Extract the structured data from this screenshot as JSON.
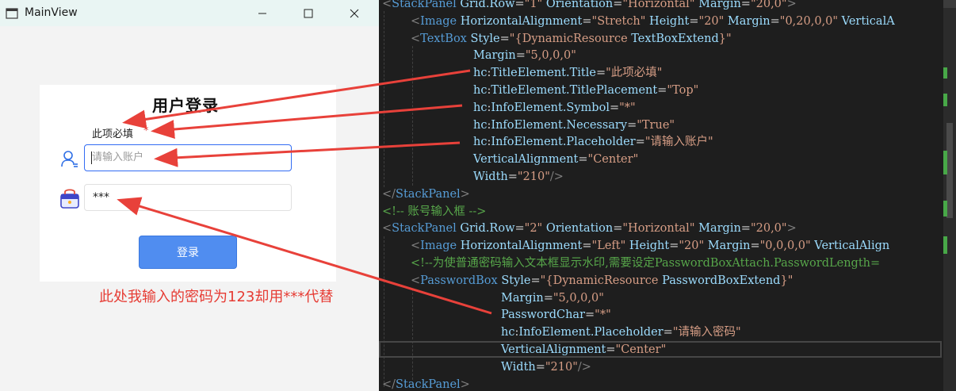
{
  "window": {
    "title": "MainView",
    "controls": {
      "minimize": "minimize",
      "maximize": "maximize",
      "close": "close"
    }
  },
  "login": {
    "title": "用户登录",
    "account": {
      "title": "此项必填",
      "required_symbol": "*",
      "placeholder": "请输入账户"
    },
    "password": {
      "value": "***"
    },
    "button": "登录"
  },
  "annotation": "此处我输入的密码为123却用***代替",
  "colors": {
    "accent": "#326cf3",
    "button": "#508df0",
    "annotation": "#e63b33",
    "required": "#e04040",
    "editor_bg": "#1e1e1e"
  },
  "code_lines": [
    [
      [
        "br",
        "<"
      ],
      [
        "tag",
        "StackPanel "
      ],
      [
        "attr",
        "Grid.Row"
      ],
      [
        "eq",
        "="
      ],
      [
        "val",
        "\"1\""
      ],
      [
        "attr",
        " Orientation"
      ],
      [
        "eq",
        "="
      ],
      [
        "val",
        "\"Horizontal\""
      ],
      [
        "attr",
        " Margin"
      ],
      [
        "eq",
        "="
      ],
      [
        "val",
        "\"20,0\""
      ],
      [
        "br",
        ">"
      ]
    ],
    [
      [
        "br",
        "<"
      ],
      [
        "tag",
        "Image "
      ],
      [
        "attr",
        "HorizontalAlignment"
      ],
      [
        "eq",
        "="
      ],
      [
        "val",
        "\"Stretch\""
      ],
      [
        "attr",
        " Height"
      ],
      [
        "eq",
        "="
      ],
      [
        "val",
        "\"20\""
      ],
      [
        "attr",
        " Margin"
      ],
      [
        "eq",
        "="
      ],
      [
        "val",
        "\"0,20,0,0\""
      ],
      [
        "attr",
        " VerticalA"
      ]
    ],
    [
      [
        "br",
        "<"
      ],
      [
        "tag",
        "TextBox "
      ],
      [
        "attr",
        "Style"
      ],
      [
        "eq",
        "="
      ],
      [
        "val",
        "\"{"
      ],
      [
        "dyn",
        "DynamicResource"
      ],
      [
        "attr",
        " TextBoxExtend"
      ],
      [
        "val",
        "}\""
      ]
    ],
    [
      [
        "attr",
        "Margin"
      ],
      [
        "eq",
        "="
      ],
      [
        "val",
        "\"5,0,0,0\""
      ]
    ],
    [
      [
        "ns",
        "hc"
      ],
      [
        "p",
        ":"
      ],
      [
        "attr",
        "TitleElement.Title"
      ],
      [
        "eq",
        "="
      ],
      [
        "val",
        "\"此项必填\""
      ]
    ],
    [
      [
        "ns",
        "hc"
      ],
      [
        "p",
        ":"
      ],
      [
        "attr",
        "TitleElement.TitlePlacement"
      ],
      [
        "eq",
        "="
      ],
      [
        "val",
        "\"Top\""
      ]
    ],
    [
      [
        "ns",
        "hc"
      ],
      [
        "p",
        ":"
      ],
      [
        "attr",
        "InfoElement.Symbol"
      ],
      [
        "eq",
        "="
      ],
      [
        "val",
        "\"*\""
      ]
    ],
    [
      [
        "ns",
        "hc"
      ],
      [
        "p",
        ":"
      ],
      [
        "attr",
        "InfoElement.Necessary"
      ],
      [
        "eq",
        "="
      ],
      [
        "val",
        "\"True\""
      ]
    ],
    [
      [
        "ns",
        "hc"
      ],
      [
        "p",
        ":"
      ],
      [
        "attr",
        "InfoElement.Placeholder"
      ],
      [
        "eq",
        "="
      ],
      [
        "val",
        "\"请输入账户\""
      ]
    ],
    [
      [
        "attr",
        "VerticalAlignment"
      ],
      [
        "eq",
        "="
      ],
      [
        "val",
        "\"Center\""
      ]
    ],
    [
      [
        "attr",
        "Width"
      ],
      [
        "eq",
        "="
      ],
      [
        "val",
        "\"210\""
      ],
      [
        "br",
        "/>"
      ]
    ],
    [
      [
        "br",
        "</"
      ],
      [
        "tag",
        "StackPanel"
      ],
      [
        "br",
        ">"
      ]
    ],
    [
      [
        "com",
        "<!-- 账号输入框 -->"
      ]
    ],
    [
      [
        "br",
        "<"
      ],
      [
        "tag",
        "StackPanel "
      ],
      [
        "attr",
        "Grid.Row"
      ],
      [
        "eq",
        "="
      ],
      [
        "val",
        "\"2\""
      ],
      [
        "attr",
        " Orientation"
      ],
      [
        "eq",
        "="
      ],
      [
        "val",
        "\"Horizontal\""
      ],
      [
        "attr",
        " Margin"
      ],
      [
        "eq",
        "="
      ],
      [
        "val",
        "\"20,0\""
      ],
      [
        "br",
        ">"
      ]
    ],
    [
      [
        "br",
        "<"
      ],
      [
        "tag",
        "Image "
      ],
      [
        "attr",
        "HorizontalAlignment"
      ],
      [
        "eq",
        "="
      ],
      [
        "val",
        "\"Left\""
      ],
      [
        "attr",
        " Height"
      ],
      [
        "eq",
        "="
      ],
      [
        "val",
        "\"20\""
      ],
      [
        "attr",
        " Margin"
      ],
      [
        "eq",
        "="
      ],
      [
        "val",
        "\"0,0,0,0\""
      ],
      [
        "attr",
        " VerticalAlign"
      ]
    ],
    [
      [
        "com",
        "<!--为使普通密码输入文本框显示水印,需要设定PasswordBoxAttach.PasswordLength="
      ]
    ],
    [
      [
        "br",
        "<"
      ],
      [
        "tag",
        "PasswordBox "
      ],
      [
        "attr",
        "Style"
      ],
      [
        "eq",
        "="
      ],
      [
        "val",
        "\"{"
      ],
      [
        "dyn",
        "DynamicResource"
      ],
      [
        "attr",
        " PasswordBoxExtend"
      ],
      [
        "val",
        "}\""
      ]
    ],
    [
      [
        "attr",
        "Margin"
      ],
      [
        "eq",
        "="
      ],
      [
        "val",
        "\"5,0,0,0\""
      ]
    ],
    [
      [
        "attr",
        "PasswordChar"
      ],
      [
        "eq",
        "="
      ],
      [
        "val",
        "\"*\""
      ]
    ],
    [
      [
        "ns",
        "hc"
      ],
      [
        "p",
        ":"
      ],
      [
        "attr",
        "InfoElement.Placeholder"
      ],
      [
        "eq",
        "="
      ],
      [
        "val",
        "\"请输入密码\""
      ]
    ],
    [
      [
        "attr",
        "VerticalAlignment"
      ],
      [
        "eq",
        "="
      ],
      [
        "val",
        "\"Center\""
      ]
    ],
    [
      [
        "attr",
        "Width"
      ],
      [
        "eq",
        "="
      ],
      [
        "val",
        "\"210\""
      ],
      [
        "br",
        "/>"
      ]
    ],
    [
      [
        "br",
        "</"
      ],
      [
        "tag",
        "StackPanel"
      ],
      [
        "br",
        ">"
      ]
    ]
  ]
}
